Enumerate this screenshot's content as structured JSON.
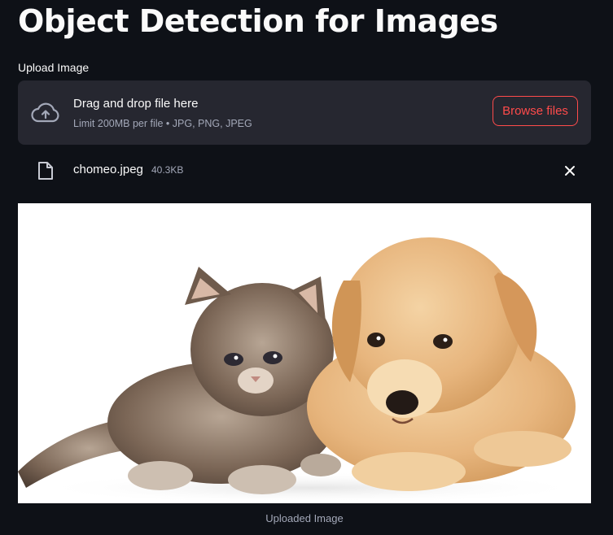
{
  "page": {
    "title": "Object Detection for Images"
  },
  "uploader": {
    "label": "Upload Image",
    "drop_title": "Drag and drop file here",
    "drop_subtitle": "Limit 200MB per file • JPG, PNG, JPEG",
    "browse_label": "Browse files",
    "accent_color": "#ff4b4b"
  },
  "uploaded_file": {
    "name": "chomeo.jpeg",
    "size": "40.3KB"
  },
  "image": {
    "caption": "Uploaded Image"
  }
}
